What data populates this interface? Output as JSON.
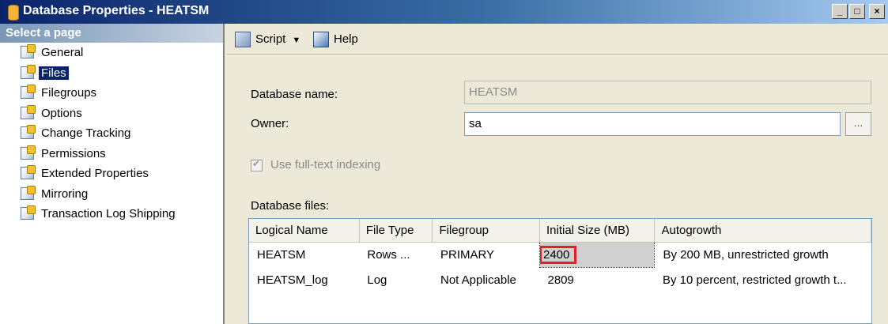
{
  "window": {
    "title": "Database Properties - HEATSM",
    "minimize": "_",
    "maximize": "□",
    "close": "×"
  },
  "sidebar": {
    "header": "Select a page",
    "items": [
      {
        "label": "General"
      },
      {
        "label": "Files"
      },
      {
        "label": "Filegroups"
      },
      {
        "label": "Options"
      },
      {
        "label": "Change Tracking"
      },
      {
        "label": "Permissions"
      },
      {
        "label": "Extended Properties"
      },
      {
        "label": "Mirroring"
      },
      {
        "label": "Transaction Log Shipping"
      }
    ],
    "selected": "Files"
  },
  "toolbar": {
    "script_label": "Script",
    "help_label": "Help"
  },
  "form": {
    "database_name_label": "Database name:",
    "database_name_value": "HEATSM",
    "owner_label": "Owner:",
    "owner_value": "sa",
    "browse_label": "...",
    "fulltext_label": "Use full-text indexing",
    "database_files_label": "Database files:"
  },
  "files_table": {
    "columns": [
      "Logical Name",
      "File Type",
      "Filegroup",
      "Initial Size (MB)",
      "Autogrowth"
    ],
    "rows": [
      [
        "HEATSM",
        "Rows ...",
        "PRIMARY",
        "2400",
        "By 200 MB, unrestricted growth"
      ],
      [
        "HEATSM_log",
        "Log",
        "Not Applicable",
        "2809",
        "By 10 percent, restricted growth t..."
      ]
    ]
  },
  "colors": {
    "title_gradient_start": "#0a246a",
    "highlight_outline": "#e12027",
    "selection_bg": "#0a246a"
  }
}
